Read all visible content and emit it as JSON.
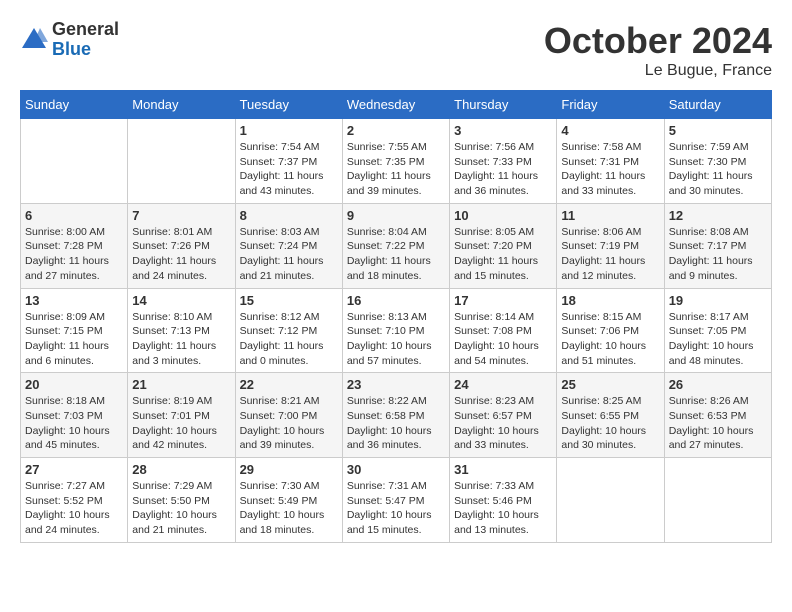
{
  "header": {
    "logo_general": "General",
    "logo_blue": "Blue",
    "month_title": "October 2024",
    "location": "Le Bugue, France"
  },
  "weekdays": [
    "Sunday",
    "Monday",
    "Tuesday",
    "Wednesday",
    "Thursday",
    "Friday",
    "Saturday"
  ],
  "weeks": [
    [
      {
        "day": "",
        "info": ""
      },
      {
        "day": "",
        "info": ""
      },
      {
        "day": "1",
        "info": "Sunrise: 7:54 AM\nSunset: 7:37 PM\nDaylight: 11 hours and 43 minutes."
      },
      {
        "day": "2",
        "info": "Sunrise: 7:55 AM\nSunset: 7:35 PM\nDaylight: 11 hours and 39 minutes."
      },
      {
        "day": "3",
        "info": "Sunrise: 7:56 AM\nSunset: 7:33 PM\nDaylight: 11 hours and 36 minutes."
      },
      {
        "day": "4",
        "info": "Sunrise: 7:58 AM\nSunset: 7:31 PM\nDaylight: 11 hours and 33 minutes."
      },
      {
        "day": "5",
        "info": "Sunrise: 7:59 AM\nSunset: 7:30 PM\nDaylight: 11 hours and 30 minutes."
      }
    ],
    [
      {
        "day": "6",
        "info": "Sunrise: 8:00 AM\nSunset: 7:28 PM\nDaylight: 11 hours and 27 minutes."
      },
      {
        "day": "7",
        "info": "Sunrise: 8:01 AM\nSunset: 7:26 PM\nDaylight: 11 hours and 24 minutes."
      },
      {
        "day": "8",
        "info": "Sunrise: 8:03 AM\nSunset: 7:24 PM\nDaylight: 11 hours and 21 minutes."
      },
      {
        "day": "9",
        "info": "Sunrise: 8:04 AM\nSunset: 7:22 PM\nDaylight: 11 hours and 18 minutes."
      },
      {
        "day": "10",
        "info": "Sunrise: 8:05 AM\nSunset: 7:20 PM\nDaylight: 11 hours and 15 minutes."
      },
      {
        "day": "11",
        "info": "Sunrise: 8:06 AM\nSunset: 7:19 PM\nDaylight: 11 hours and 12 minutes."
      },
      {
        "day": "12",
        "info": "Sunrise: 8:08 AM\nSunset: 7:17 PM\nDaylight: 11 hours and 9 minutes."
      }
    ],
    [
      {
        "day": "13",
        "info": "Sunrise: 8:09 AM\nSunset: 7:15 PM\nDaylight: 11 hours and 6 minutes."
      },
      {
        "day": "14",
        "info": "Sunrise: 8:10 AM\nSunset: 7:13 PM\nDaylight: 11 hours and 3 minutes."
      },
      {
        "day": "15",
        "info": "Sunrise: 8:12 AM\nSunset: 7:12 PM\nDaylight: 11 hours and 0 minutes."
      },
      {
        "day": "16",
        "info": "Sunrise: 8:13 AM\nSunset: 7:10 PM\nDaylight: 10 hours and 57 minutes."
      },
      {
        "day": "17",
        "info": "Sunrise: 8:14 AM\nSunset: 7:08 PM\nDaylight: 10 hours and 54 minutes."
      },
      {
        "day": "18",
        "info": "Sunrise: 8:15 AM\nSunset: 7:06 PM\nDaylight: 10 hours and 51 minutes."
      },
      {
        "day": "19",
        "info": "Sunrise: 8:17 AM\nSunset: 7:05 PM\nDaylight: 10 hours and 48 minutes."
      }
    ],
    [
      {
        "day": "20",
        "info": "Sunrise: 8:18 AM\nSunset: 7:03 PM\nDaylight: 10 hours and 45 minutes."
      },
      {
        "day": "21",
        "info": "Sunrise: 8:19 AM\nSunset: 7:01 PM\nDaylight: 10 hours and 42 minutes."
      },
      {
        "day": "22",
        "info": "Sunrise: 8:21 AM\nSunset: 7:00 PM\nDaylight: 10 hours and 39 minutes."
      },
      {
        "day": "23",
        "info": "Sunrise: 8:22 AM\nSunset: 6:58 PM\nDaylight: 10 hours and 36 minutes."
      },
      {
        "day": "24",
        "info": "Sunrise: 8:23 AM\nSunset: 6:57 PM\nDaylight: 10 hours and 33 minutes."
      },
      {
        "day": "25",
        "info": "Sunrise: 8:25 AM\nSunset: 6:55 PM\nDaylight: 10 hours and 30 minutes."
      },
      {
        "day": "26",
        "info": "Sunrise: 8:26 AM\nSunset: 6:53 PM\nDaylight: 10 hours and 27 minutes."
      }
    ],
    [
      {
        "day": "27",
        "info": "Sunrise: 7:27 AM\nSunset: 5:52 PM\nDaylight: 10 hours and 24 minutes."
      },
      {
        "day": "28",
        "info": "Sunrise: 7:29 AM\nSunset: 5:50 PM\nDaylight: 10 hours and 21 minutes."
      },
      {
        "day": "29",
        "info": "Sunrise: 7:30 AM\nSunset: 5:49 PM\nDaylight: 10 hours and 18 minutes."
      },
      {
        "day": "30",
        "info": "Sunrise: 7:31 AM\nSunset: 5:47 PM\nDaylight: 10 hours and 15 minutes."
      },
      {
        "day": "31",
        "info": "Sunrise: 7:33 AM\nSunset: 5:46 PM\nDaylight: 10 hours and 13 minutes."
      },
      {
        "day": "",
        "info": ""
      },
      {
        "day": "",
        "info": ""
      }
    ]
  ]
}
